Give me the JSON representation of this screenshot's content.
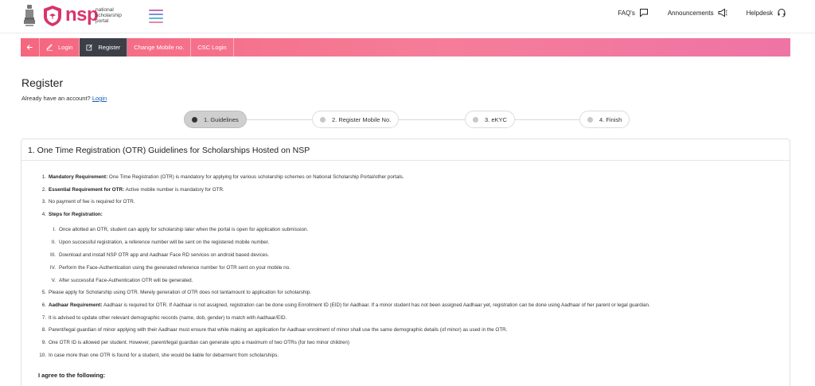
{
  "header": {
    "brand": "nsp",
    "brand_sub": [
      "national",
      "scholarship",
      "portal"
    ],
    "links": [
      {
        "label": "FAQ's",
        "icon": "chat-icon"
      },
      {
        "label": "Announcements",
        "icon": "megaphone-icon"
      },
      {
        "label": "Helpdesk",
        "icon": "headset-icon"
      }
    ]
  },
  "nav": {
    "items": [
      "Login",
      "Register",
      "Change Mobile no.",
      "CSC Login"
    ],
    "active": "Register"
  },
  "page": {
    "title": "Register",
    "account_prompt": "Already have an account?",
    "login_link": "Login"
  },
  "stepper": {
    "steps": [
      "1. Guidelines",
      "2. Register Mobile No.",
      "3. eKYC",
      "4. Finish"
    ],
    "active": "1. Guidelines"
  },
  "guidelines": {
    "title": "1. One Time Registration (OTR) Guidelines for Scholarships Hosted on NSP",
    "items": [
      {
        "num": "1.",
        "bold": "Mandatory Requirement:",
        "text": " One Time Registration (OTR) is mandatory for applying for various scholarship schemes on National Scholarship Portal/other portals."
      },
      {
        "num": "2.",
        "bold": "Essential Requirement for OTR:",
        "text": " Active mobile number is mandatory for OTR."
      },
      {
        "num": "3.",
        "bold": "",
        "text": "No payment of fee is required for OTR."
      },
      {
        "num": "4.",
        "bold": "Steps for Registration:",
        "text": ""
      },
      {
        "num": "5.",
        "bold": "",
        "text": "Please apply for Scholarship using OTR. Merely generation of OTR does not tantamount to application for scholarship."
      },
      {
        "num": "6.",
        "bold": "Aadhaar Requirement:",
        "text": " Aadhaar is required for OTR. If Aadhaar is not assigned, registration can be done using Enrollment ID (EID) for Aadhaar. If a minor student has not been assigned Aadhaar yet, registration can be done using Aadhaar of her parent or legal guardian."
      },
      {
        "num": "7.",
        "bold": "",
        "text": "It is advised to update other relevant demographic records (name, dob, gender) to match with Aadhaar/EID."
      },
      {
        "num": "8.",
        "bold": "",
        "text": "Parent/legal guardian of minor applying with their Aadhaar must ensure that while making an application for Aadhaar enrolment of minor shall use the same demographic details (of minor) as used in the OTR."
      },
      {
        "num": "9.",
        "bold": "",
        "text": "One OTR ID is allowed per student. However, parent/legal guardian can generate upto a maximum of two OTRs (for two minor children)"
      },
      {
        "num": "10.",
        "bold": "",
        "text": "In case more than one OTR is found for a student, she would be liable for debarment from scholarships."
      }
    ],
    "steps": [
      {
        "num": "I.",
        "text": "Once allotted an OTR, student can apply for scholarship later when the portal is open for application submission."
      },
      {
        "num": "II.",
        "text": "Upon successful registration, a reference number will be sent on the registered mobile number."
      },
      {
        "num": "III.",
        "text": "Download and install NSP OTR app and Aadhaar Face RD services on android based devices."
      },
      {
        "num": "IV.",
        "text": "Perform the Face-Authentication using the generated reference number for OTR sent on your mobile no."
      },
      {
        "num": "V.",
        "text": "After successful Face-Authentication OTR will be generated."
      }
    ],
    "agree_heading": "I agree to the following:"
  }
}
